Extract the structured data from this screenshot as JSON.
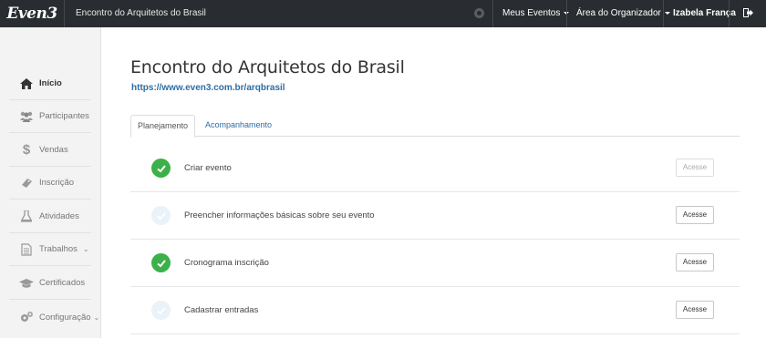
{
  "topbar": {
    "logo": "Even3",
    "event_name": "Encontro do Arquitetos do Brasil",
    "menu_eventos": "Meus Eventos",
    "menu_organizador": "Área do Organizador",
    "user_name": "Izabela França"
  },
  "sidebar": {
    "items": [
      {
        "label": "Início",
        "icon": "home-icon",
        "active": true
      },
      {
        "label": "Participantes",
        "icon": "users-icon"
      },
      {
        "label": "Vendas",
        "icon": "dollar-icon"
      },
      {
        "label": "Inscrição",
        "icon": "ticket-icon"
      },
      {
        "label": "Atividades",
        "icon": "flask-icon"
      },
      {
        "label": "Trabalhos",
        "icon": "document-icon",
        "expandable": true
      },
      {
        "label": "Certificados",
        "icon": "graduation-cap-icon"
      },
      {
        "label": "Configuração",
        "icon": "gears-icon",
        "expandable": true
      }
    ]
  },
  "main": {
    "title": "Encontro do Arquitetos do Brasil",
    "url": "https://www.even3.com.br/arqbrasil",
    "tabs": [
      {
        "label": "Planejamento",
        "active": true
      },
      {
        "label": "Acompanhamento",
        "active": false
      }
    ],
    "tasks": [
      {
        "label": "Criar evento",
        "done": true,
        "button": "Acesse",
        "button_enabled": false
      },
      {
        "label": "Preencher informações básicas sobre seu evento",
        "done": false,
        "button": "Acesse",
        "button_enabled": true
      },
      {
        "label": "Cronograma inscrição",
        "done": true,
        "button": "Acesse",
        "button_enabled": true
      },
      {
        "label": "Cadastrar entradas",
        "done": false,
        "button": "Acesse",
        "button_enabled": true
      }
    ]
  },
  "colors": {
    "topbar_bg": "#292c30",
    "link_blue": "#2e6da4",
    "check_green": "#3cb04a",
    "check_pending": "#eaf2fa"
  }
}
